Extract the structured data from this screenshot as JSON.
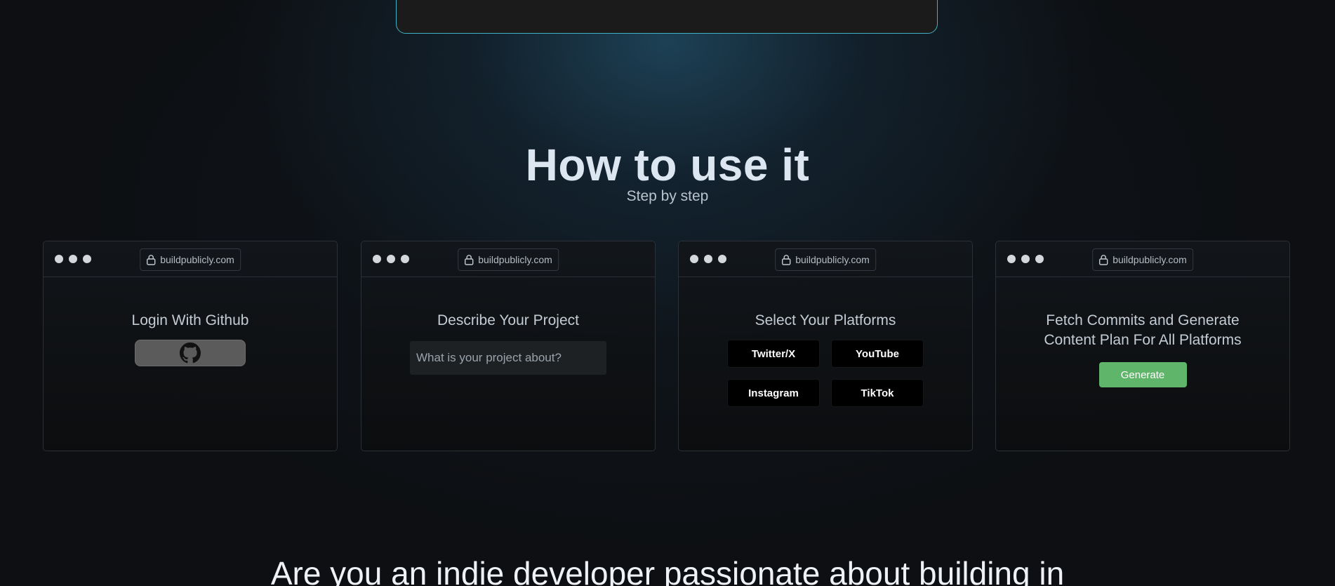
{
  "section": {
    "title": "How to use it",
    "subtitle": "Step by step"
  },
  "browser_url": "buildpublicly.com",
  "steps": [
    {
      "heading": "Login With Github",
      "button_icon": "github-icon"
    },
    {
      "heading": "Describe Your Project",
      "input_placeholder": "What is your project about?",
      "input_value": ""
    },
    {
      "heading": "Select Your Platforms",
      "platforms": [
        "Twitter/X",
        "YouTube",
        "Instagram",
        "TikTok"
      ]
    },
    {
      "heading_line1": "Fetch Commits and Generate",
      "heading_line2": "Content Plan For All Platforms",
      "button_label": "Generate"
    }
  ],
  "bottom_headline": "Are you an indie developer passionate about building in",
  "colors": {
    "accent_frame": "#3fb1c4",
    "generate_button": "#5fb66a",
    "github_button": "#5b5b5b",
    "background": "#0d0f12"
  },
  "icons": {
    "window_dots": "traffic-dots",
    "url_lock": "lock-icon",
    "github": "github-icon"
  }
}
